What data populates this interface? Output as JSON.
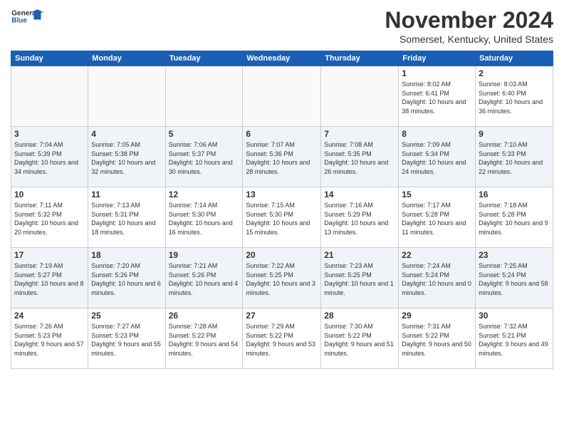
{
  "header": {
    "logo_line1": "General",
    "logo_line2": "Blue",
    "main_title": "November 2024",
    "subtitle": "Somerset, Kentucky, United States"
  },
  "weekdays": [
    "Sunday",
    "Monday",
    "Tuesday",
    "Wednesday",
    "Thursday",
    "Friday",
    "Saturday"
  ],
  "weeks": [
    [
      {
        "day": "",
        "info": ""
      },
      {
        "day": "",
        "info": ""
      },
      {
        "day": "",
        "info": ""
      },
      {
        "day": "",
        "info": ""
      },
      {
        "day": "",
        "info": ""
      },
      {
        "day": "1",
        "info": "Sunrise: 8:02 AM\nSunset: 6:41 PM\nDaylight: 10 hours and 38 minutes."
      },
      {
        "day": "2",
        "info": "Sunrise: 8:03 AM\nSunset: 6:40 PM\nDaylight: 10 hours and 36 minutes."
      }
    ],
    [
      {
        "day": "3",
        "info": "Sunrise: 7:04 AM\nSunset: 5:39 PM\nDaylight: 10 hours and 34 minutes."
      },
      {
        "day": "4",
        "info": "Sunrise: 7:05 AM\nSunset: 5:38 PM\nDaylight: 10 hours and 32 minutes."
      },
      {
        "day": "5",
        "info": "Sunrise: 7:06 AM\nSunset: 5:37 PM\nDaylight: 10 hours and 30 minutes."
      },
      {
        "day": "6",
        "info": "Sunrise: 7:07 AM\nSunset: 5:36 PM\nDaylight: 10 hours and 28 minutes."
      },
      {
        "day": "7",
        "info": "Sunrise: 7:08 AM\nSunset: 5:35 PM\nDaylight: 10 hours and 26 minutes."
      },
      {
        "day": "8",
        "info": "Sunrise: 7:09 AM\nSunset: 5:34 PM\nDaylight: 10 hours and 24 minutes."
      },
      {
        "day": "9",
        "info": "Sunrise: 7:10 AM\nSunset: 5:33 PM\nDaylight: 10 hours and 22 minutes."
      }
    ],
    [
      {
        "day": "10",
        "info": "Sunrise: 7:11 AM\nSunset: 5:32 PM\nDaylight: 10 hours and 20 minutes."
      },
      {
        "day": "11",
        "info": "Sunrise: 7:13 AM\nSunset: 5:31 PM\nDaylight: 10 hours and 18 minutes."
      },
      {
        "day": "12",
        "info": "Sunrise: 7:14 AM\nSunset: 5:30 PM\nDaylight: 10 hours and 16 minutes."
      },
      {
        "day": "13",
        "info": "Sunrise: 7:15 AM\nSunset: 5:30 PM\nDaylight: 10 hours and 15 minutes."
      },
      {
        "day": "14",
        "info": "Sunrise: 7:16 AM\nSunset: 5:29 PM\nDaylight: 10 hours and 13 minutes."
      },
      {
        "day": "15",
        "info": "Sunrise: 7:17 AM\nSunset: 5:28 PM\nDaylight: 10 hours and 11 minutes."
      },
      {
        "day": "16",
        "info": "Sunrise: 7:18 AM\nSunset: 5:28 PM\nDaylight: 10 hours and 9 minutes."
      }
    ],
    [
      {
        "day": "17",
        "info": "Sunrise: 7:19 AM\nSunset: 5:27 PM\nDaylight: 10 hours and 8 minutes."
      },
      {
        "day": "18",
        "info": "Sunrise: 7:20 AM\nSunset: 5:26 PM\nDaylight: 10 hours and 6 minutes."
      },
      {
        "day": "19",
        "info": "Sunrise: 7:21 AM\nSunset: 5:26 PM\nDaylight: 10 hours and 4 minutes."
      },
      {
        "day": "20",
        "info": "Sunrise: 7:22 AM\nSunset: 5:25 PM\nDaylight: 10 hours and 3 minutes."
      },
      {
        "day": "21",
        "info": "Sunrise: 7:23 AM\nSunset: 5:25 PM\nDaylight: 10 hours and 1 minute."
      },
      {
        "day": "22",
        "info": "Sunrise: 7:24 AM\nSunset: 5:24 PM\nDaylight: 10 hours and 0 minutes."
      },
      {
        "day": "23",
        "info": "Sunrise: 7:25 AM\nSunset: 5:24 PM\nDaylight: 9 hours and 58 minutes."
      }
    ],
    [
      {
        "day": "24",
        "info": "Sunrise: 7:26 AM\nSunset: 5:23 PM\nDaylight: 9 hours and 57 minutes."
      },
      {
        "day": "25",
        "info": "Sunrise: 7:27 AM\nSunset: 5:23 PM\nDaylight: 9 hours and 55 minutes."
      },
      {
        "day": "26",
        "info": "Sunrise: 7:28 AM\nSunset: 5:22 PM\nDaylight: 9 hours and 54 minutes."
      },
      {
        "day": "27",
        "info": "Sunrise: 7:29 AM\nSunset: 5:22 PM\nDaylight: 9 hours and 53 minutes."
      },
      {
        "day": "28",
        "info": "Sunrise: 7:30 AM\nSunset: 5:22 PM\nDaylight: 9 hours and 51 minutes."
      },
      {
        "day": "29",
        "info": "Sunrise: 7:31 AM\nSunset: 5:22 PM\nDaylight: 9 hours and 50 minutes."
      },
      {
        "day": "30",
        "info": "Sunrise: 7:32 AM\nSunset: 5:21 PM\nDaylight: 9 hours and 49 minutes."
      }
    ]
  ]
}
